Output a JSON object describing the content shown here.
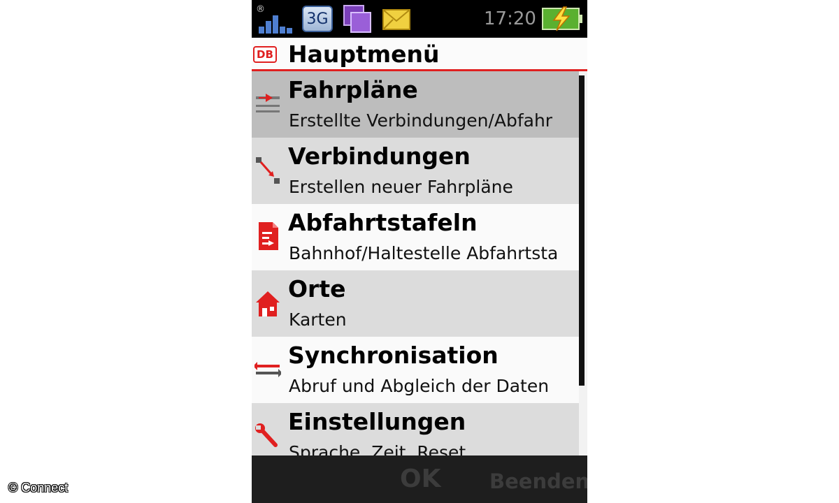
{
  "status_bar": {
    "network_badge": "3G",
    "time": "17:20",
    "signal_icon": "signal-bars-icon",
    "message_icon": "message-icon",
    "mail_icon": "envelope-icon",
    "battery_icon": "battery-charging-icon"
  },
  "header": {
    "logo_text": "DB",
    "title": "Hauptmenü"
  },
  "menu": {
    "items": [
      {
        "title": "Fahrpläne",
        "subtitle": "Erstellte Verbindungen/Abfahr",
        "icon": "timetable-icon"
      },
      {
        "title": "Verbindungen",
        "subtitle": "Erstellen neuer Fahrpläne",
        "icon": "route-icon"
      },
      {
        "title": "Abfahrtstafeln",
        "subtitle": "Bahnhof/Haltestelle Abfahrtsta",
        "icon": "departure-board-icon"
      },
      {
        "title": "Orte",
        "subtitle": "Karten",
        "icon": "house-icon"
      },
      {
        "title": "Synchronisation",
        "subtitle": "Abruf und Abgleich der Daten",
        "icon": "sync-icon"
      },
      {
        "title": "Einstellungen",
        "subtitle": "Sprache, Zeit, Reset",
        "icon": "wrench-icon"
      }
    ]
  },
  "softkeys": {
    "ok": "OK",
    "exit": "Beenden"
  },
  "watermark": "© Connect",
  "colors": {
    "accent": "#e02020",
    "selected_row": "#bdbdbd",
    "statusbar": "#000000",
    "softkey_bar": "#1e1e1e"
  }
}
